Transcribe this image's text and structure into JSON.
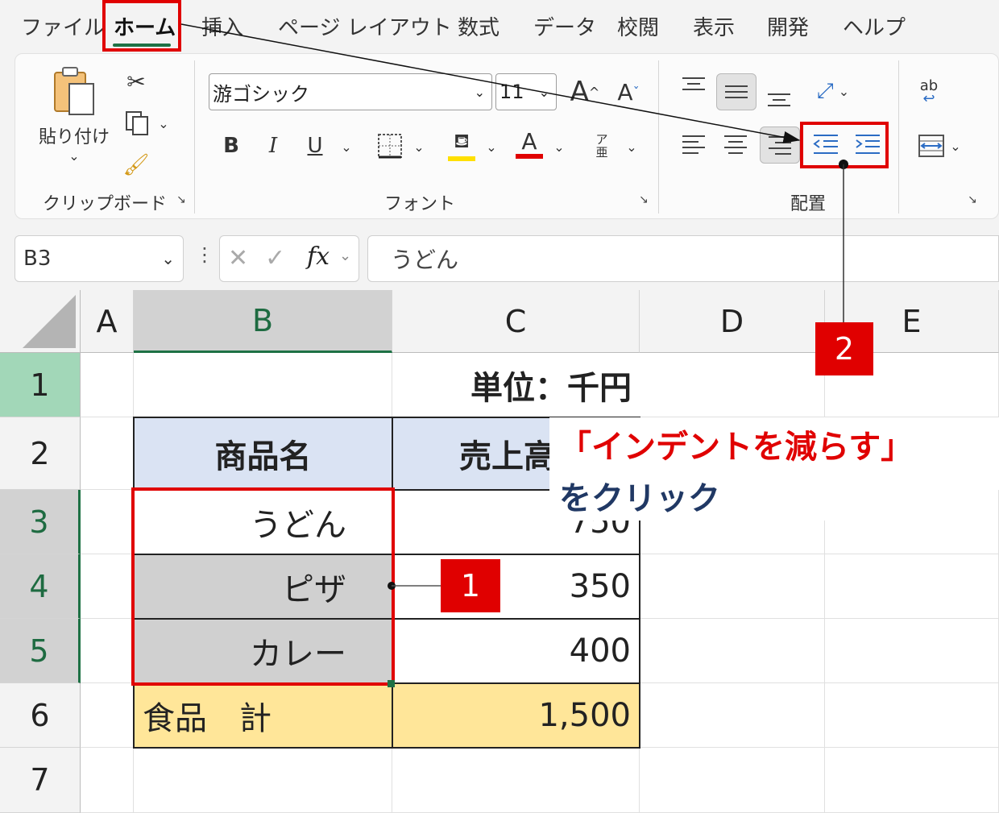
{
  "tabs": [
    "ファイル",
    "ホーム",
    "挿入",
    "ページ レイアウト",
    "数式",
    "データ",
    "校閲",
    "表示",
    "開発",
    "ヘルプ"
  ],
  "active_tab": "ホーム",
  "ribbon": {
    "clipboard": {
      "paste_label": "貼り付け",
      "group_label": "クリップボード"
    },
    "font": {
      "font_name": "游ゴシック",
      "font_size": "11",
      "bold": "B",
      "italic": "I",
      "underline": "U",
      "font_color_glyph": "A",
      "grow_glyph": "A",
      "shrink_glyph": "A",
      "phonetic_glyph": "ア亜",
      "group_label": "フォント",
      "underline_color": "#ffe000",
      "font_color": "#e00000"
    },
    "alignment": {
      "group_label": "配置"
    },
    "wrap_glyph": "ab"
  },
  "formula_bar": {
    "name_box": "B3",
    "fx": "fx",
    "content": "うどん"
  },
  "columns": [
    "A",
    "B",
    "C",
    "D",
    "E"
  ],
  "rows": [
    "1",
    "2",
    "3",
    "4",
    "5",
    "6",
    "7"
  ],
  "cells": {
    "c1": "単位：千円",
    "b2": "商品名",
    "c2": "売上高",
    "b3": "うどん",
    "c3": "750",
    "b4": "ピザ",
    "c4": "350",
    "b5": "カレー",
    "c5": "400",
    "b6": "食品　計",
    "c6": "1,500"
  },
  "callouts": {
    "badge1": "1",
    "badge2": "2",
    "note_line1": "「インデントを減らす」",
    "note_line2": "をクリック"
  },
  "colors": {
    "header_fill": "#dae3f3",
    "total_fill": "#ffe699",
    "selected_fill": "#d0d0d0",
    "highlight": "#e00000",
    "accent": "#1e7145"
  }
}
